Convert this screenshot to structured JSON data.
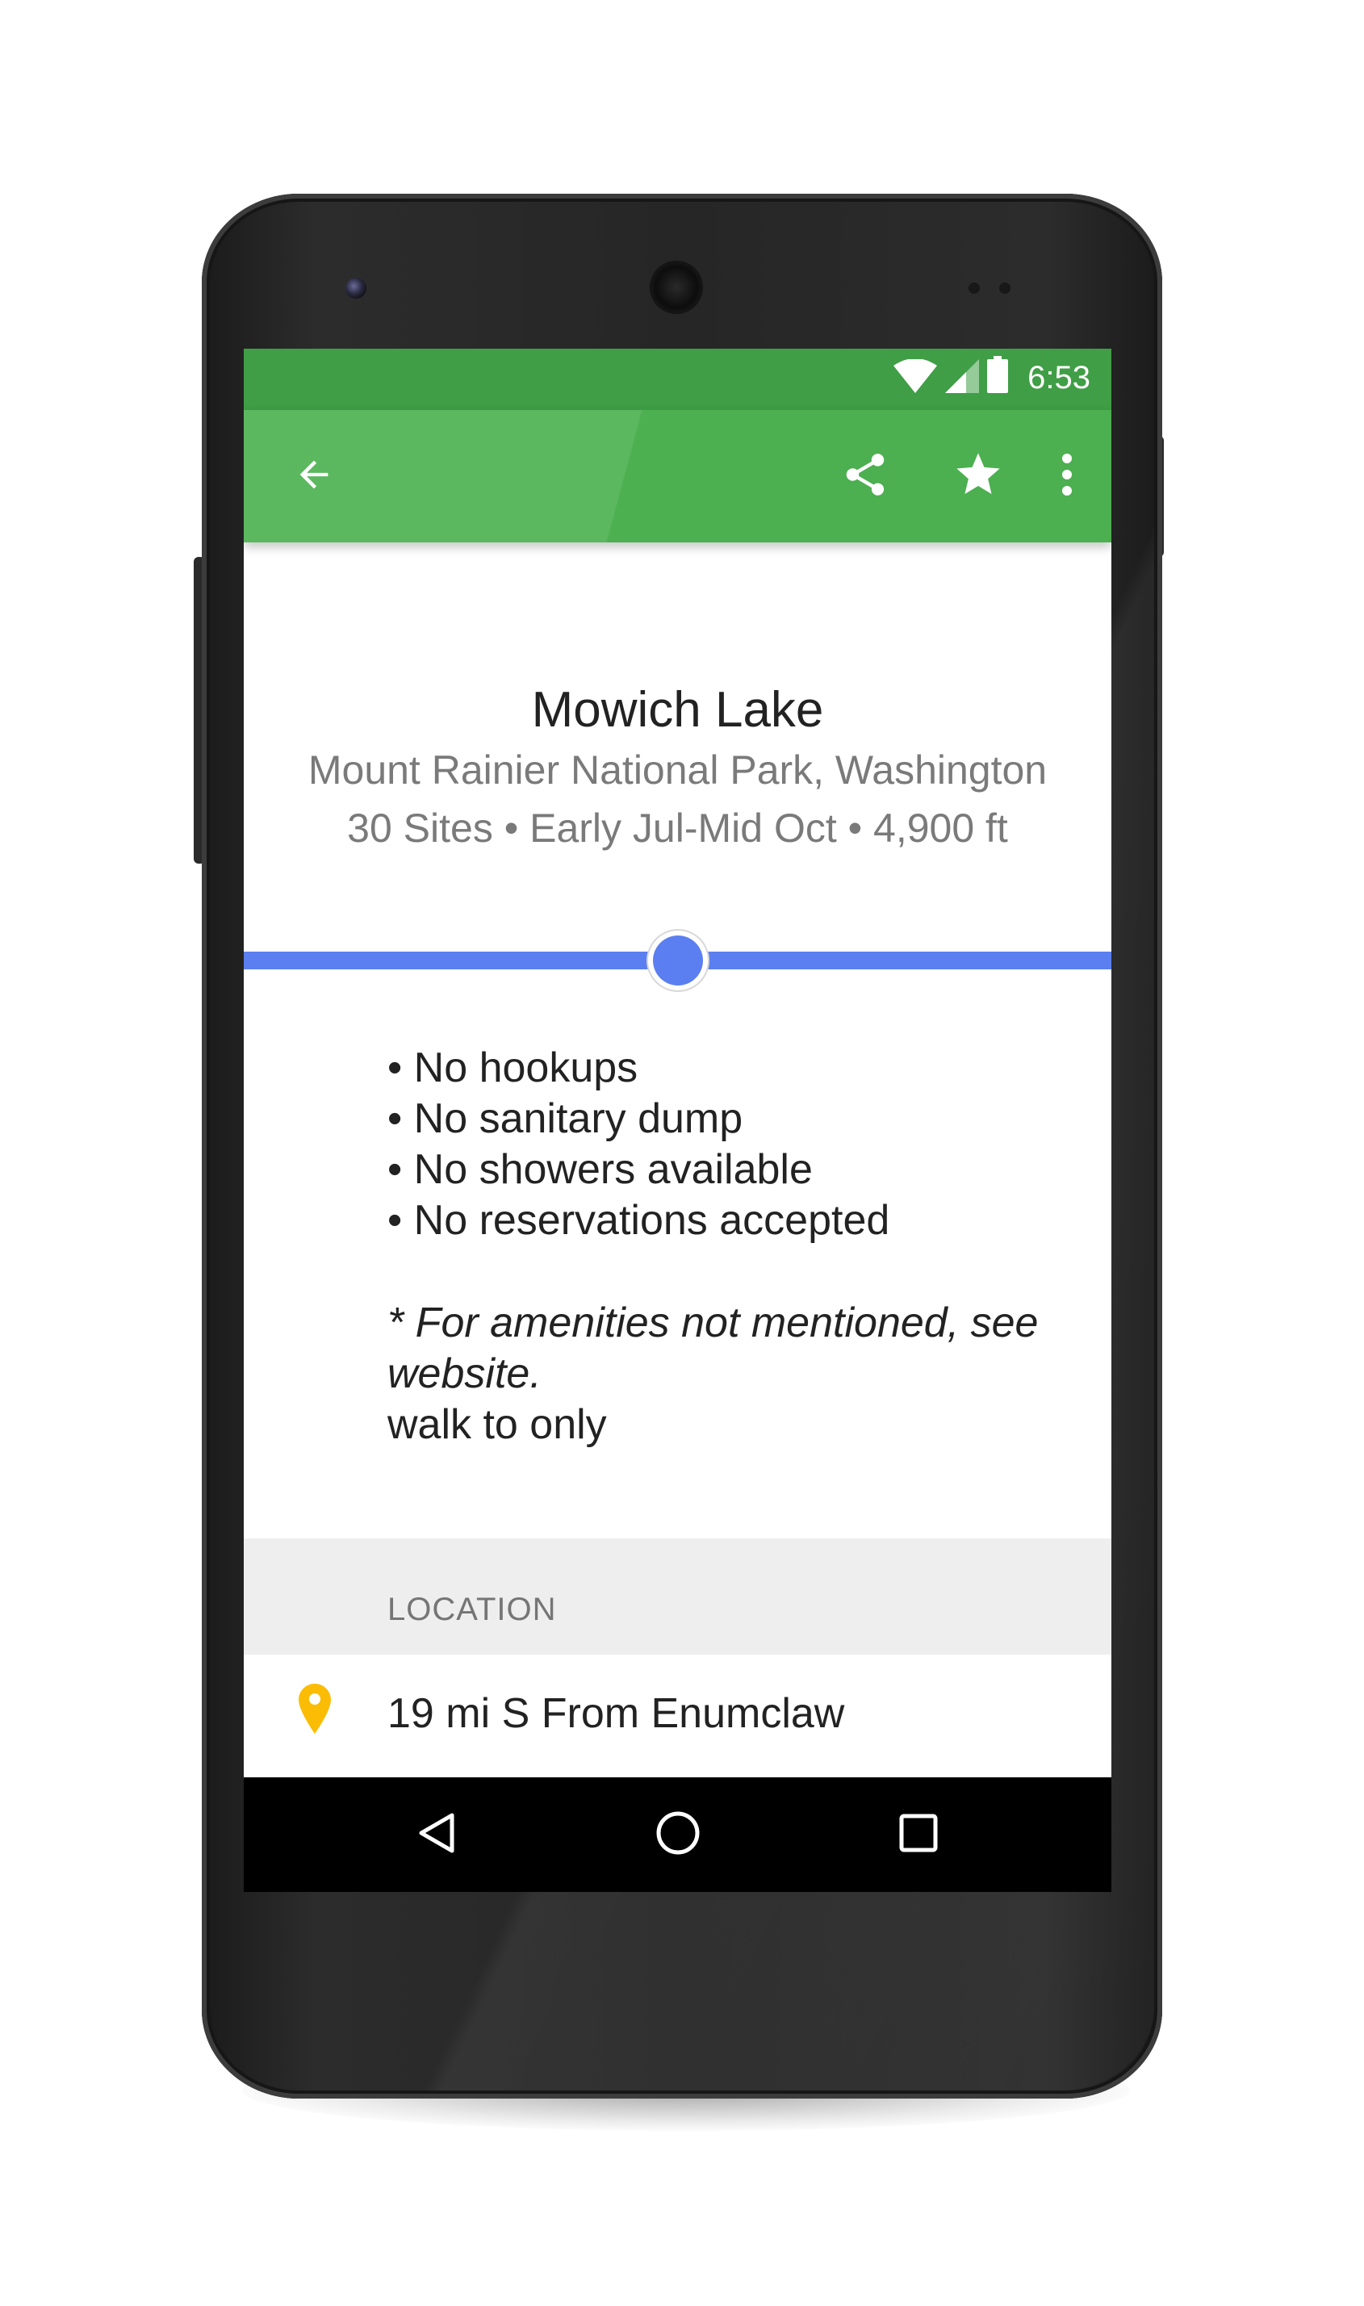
{
  "status_bar": {
    "time": "6:53",
    "icons": [
      "wifi-icon",
      "cell-signal-icon",
      "battery-icon"
    ],
    "color": "#3f9e46"
  },
  "app_bar": {
    "color": "#4caf50",
    "icons": [
      "back-arrow-icon",
      "share-icon",
      "star-icon",
      "more-vert-icon"
    ]
  },
  "campground": {
    "name": "Mowich Lake",
    "park": "Mount Rainier National Park, Washington",
    "details": "30 Sites • Early Jul-Mid Oct • 4,900 ft"
  },
  "slider": {
    "value": 0.5,
    "color": "#5b7ff0"
  },
  "amenities": [
    "• No hookups",
    "• No sanitary dump",
    "• No showers available",
    "• No reservations accepted"
  ],
  "note": "* For amenities not mentioned, see website.",
  "access": "walk to only",
  "location": {
    "header": "LOCATION",
    "text": "19 mi S From Enumclaw",
    "pin_color": "#fbbc05"
  },
  "nav_bar": {
    "buttons": [
      "back-triangle-icon",
      "home-circle-icon",
      "recents-square-icon"
    ]
  }
}
